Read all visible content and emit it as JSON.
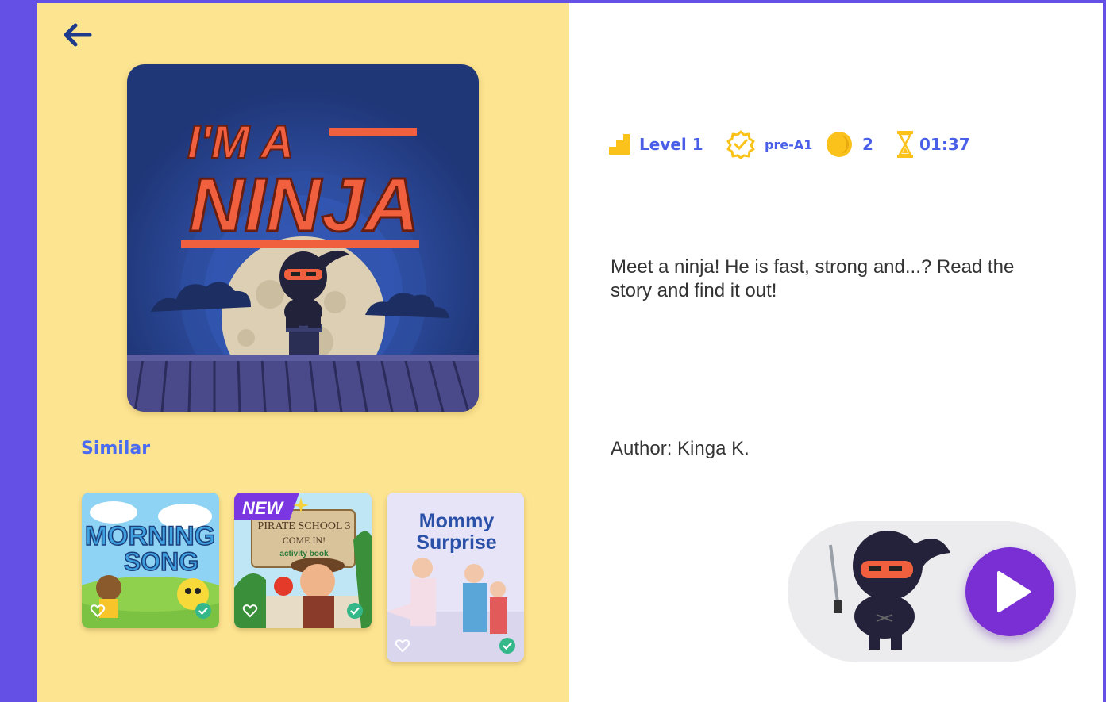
{
  "nav": {
    "back_icon": "arrow-left-icon"
  },
  "book": {
    "cover_title_line1": "I'M A",
    "cover_title_line2": "NINJA",
    "level": "Level 1",
    "cefr": "pre-A1",
    "coins": "2",
    "duration": "01:37",
    "description": "Meet a ninja! He is fast, strong and...? Read the story and find it out!",
    "author": "Author: Kinga K."
  },
  "similar": {
    "title": "Similar",
    "items": [
      {
        "title_line1": "MORNING",
        "title_line2": "SONG",
        "badge": ""
      },
      {
        "title_line1": "PIRATE SCHOOL 3",
        "title_line2": "COME IN!",
        "subtitle": "activity book",
        "badge": "NEW"
      },
      {
        "title_line1": "Mommy",
        "title_line2": "Surprise",
        "badge": ""
      }
    ]
  },
  "colors": {
    "background": "#6550e6",
    "left_panel": "#fde491",
    "accent_blue": "#4a5fe8",
    "icon_yellow": "#fbc21c",
    "play_button": "#7a2fd4"
  },
  "icons": [
    "level-bars-icon",
    "badge-check-icon",
    "coin-icon",
    "hourglass-icon",
    "heart-icon",
    "check-circle-icon",
    "play-icon"
  ]
}
